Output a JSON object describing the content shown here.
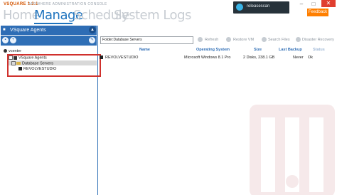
{
  "app": {
    "name": "VSQUARE 1.3.1",
    "subtitle": "ANYWHERE ADMINISTRATION CONSOLE"
  },
  "nav": {
    "tabs": [
      {
        "label": "Home"
      },
      {
        "label": "Manage"
      },
      {
        "label": "Schedule"
      },
      {
        "label": "System Logs"
      }
    ],
    "active": "Manage"
  },
  "header": {
    "release_label": "releasescan",
    "feedback_label": "Feedback",
    "win_minimize": "–",
    "win_maximize": "□",
    "win_close": "✕"
  },
  "left_panel": {
    "title": "VSquare Agents",
    "tree": [
      {
        "label": "vcenter",
        "icon": "vcenter-icon"
      },
      {
        "label": "VSquare Agents",
        "icon": "agents-icon"
      },
      {
        "label": "Database Servers",
        "icon": "folder-icon",
        "selected": true
      },
      {
        "label": "REVOLVESTUDIO",
        "icon": "server-icon"
      }
    ]
  },
  "toolbar": {
    "path_value": "Folder:Database Servers",
    "refresh": "Refresh",
    "restore_vm": "Restore VM",
    "search_files": "Search Files",
    "disaster_recovery": "Disaster Recovery"
  },
  "grid": {
    "columns": [
      "Name",
      "Operating System",
      "Size",
      "Last Backup",
      "Status"
    ],
    "rows": [
      {
        "name": "REVOLVESTUDIO",
        "os": "Microsoft Windows 8.1 Pro",
        "size": "2 Disks, 238.1 GB",
        "last_backup": "Never",
        "status": "Ok"
      }
    ]
  },
  "colors": {
    "accent": "#1e73be",
    "panel_blue": "#2e6db5",
    "orange": "#ff7f00",
    "brand_orange": "#d35400",
    "highlight_red": "#d0312d"
  }
}
